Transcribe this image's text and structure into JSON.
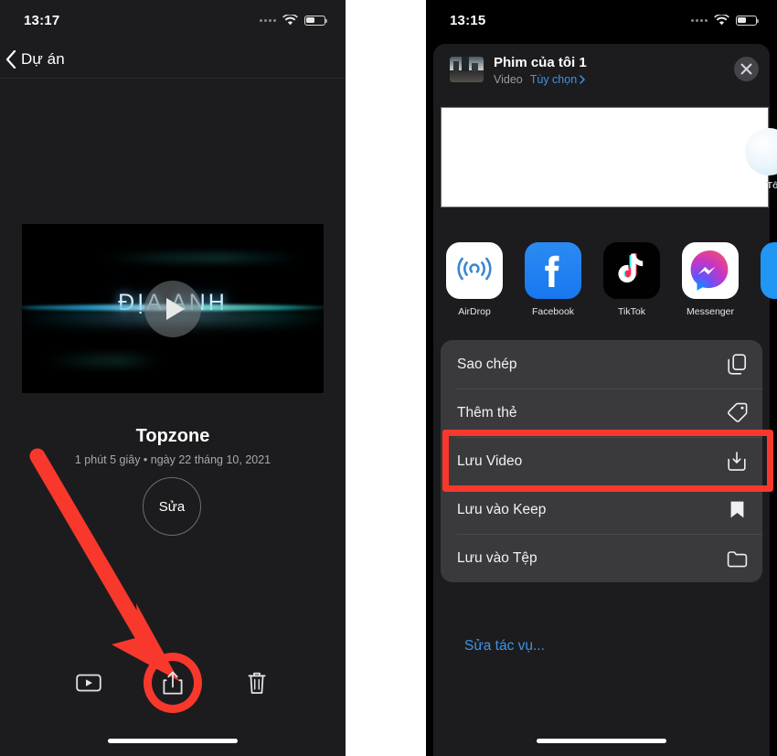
{
  "left_phone": {
    "status_bar": {
      "time": "13:17",
      "wifi_icon": "wifi-icon",
      "battery_icon": "battery-icon",
      "signal_icon": "signal-dots-icon"
    },
    "nav": {
      "back_icon": "chevron-left-icon",
      "back_label": "Dự án"
    },
    "video": {
      "overlay_title": "ĐỊA ANH",
      "play_icon": "play-icon"
    },
    "media": {
      "title": "Topzone",
      "subtitle": "1 phút 5 giây • ngày 22 tháng 10, 2021",
      "edit_label": "Sửa"
    },
    "toolbar": [
      {
        "name": "play-video-button",
        "icon": "play-rect-icon"
      },
      {
        "name": "share-button",
        "icon": "share-icon"
      },
      {
        "name": "delete-button",
        "icon": "trash-icon"
      }
    ],
    "annotation": {
      "arrow_color": "#f8382c",
      "highlight_color": "#f8382c"
    }
  },
  "right_phone": {
    "status_bar": {
      "time": "13:15",
      "wifi_icon": "wifi-icon",
      "battery_icon": "battery-icon",
      "signal_icon": "signal-dots-icon"
    },
    "share_sheet": {
      "item_name": "Phim của tôi 1",
      "item_type": "Video",
      "options_label": "Tùy chọn",
      "options_chevron_icon": "chevron-right-icon",
      "close_icon": "close-icon",
      "thumbnail_icon": "video-thumbnail",
      "contact_peek_label": "Tô",
      "apps": [
        {
          "label": "AirDrop",
          "icon": "airdrop-icon"
        },
        {
          "label": "Facebook",
          "icon": "facebook-icon"
        },
        {
          "label": "TikTok",
          "icon": "tiktok-icon"
        },
        {
          "label": "Messenger",
          "icon": "messenger-icon"
        }
      ],
      "actions": [
        {
          "label": "Sao chép",
          "icon": "copy-icon",
          "highlighted": false
        },
        {
          "label": "Thêm thẻ",
          "icon": "tag-icon",
          "highlighted": false
        },
        {
          "label": "Lưu Video",
          "icon": "save-download-icon",
          "highlighted": true
        },
        {
          "label": "Lưu vào Keep",
          "icon": "bookmark-icon",
          "highlighted": false
        },
        {
          "label": "Lưu vào Tệp",
          "icon": "folder-icon",
          "highlighted": false
        }
      ],
      "edit_actions_label": "Sửa tác vụ..."
    }
  },
  "colors": {
    "accent_red": "#f8382c",
    "sheet_bg": "#1c1c1e",
    "card_bg": "#3a3a3c",
    "link_blue": "#3f93e6"
  }
}
